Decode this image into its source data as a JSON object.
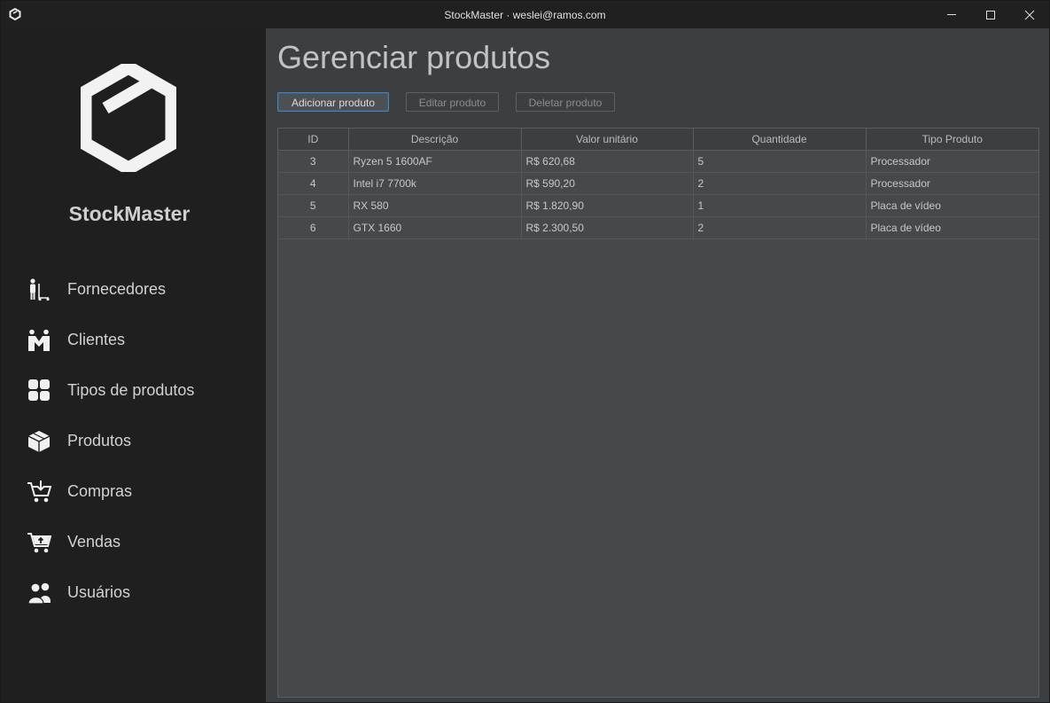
{
  "window": {
    "title": "StockMaster · weslei@ramos.com"
  },
  "sidebar": {
    "brand": "StockMaster",
    "items": [
      {
        "label": "Fornecedores",
        "icon": "supplier-dolly-icon"
      },
      {
        "label": "Clientes",
        "icon": "clients-icon"
      },
      {
        "label": "Tipos de produtos",
        "icon": "categories-grid-icon"
      },
      {
        "label": "Produtos",
        "icon": "box-icon"
      },
      {
        "label": "Compras",
        "icon": "cart-download-icon"
      },
      {
        "label": "Vendas",
        "icon": "cart-upload-icon"
      },
      {
        "label": "Usuários",
        "icon": "users-icon"
      }
    ]
  },
  "main": {
    "title": "Gerenciar produtos",
    "buttons": {
      "add": "Adicionar produto",
      "edit": "Editar produto",
      "delete": "Deletar produto"
    },
    "table": {
      "columns": [
        "ID",
        "Descrição",
        "Valor unitário",
        "Quantidade",
        "Tipo Produto"
      ],
      "rows": [
        [
          "3",
          "Ryzen 5 1600AF",
          "R$ 620,68",
          "5",
          "Processador"
        ],
        [
          "4",
          "Intel i7 7700k",
          "R$ 590,20",
          "2",
          "Processador"
        ],
        [
          "5",
          "RX 580",
          "R$ 1.820,90",
          "1",
          "Placa de vídeo"
        ],
        [
          "6",
          "GTX 1660",
          "R$ 2.300,50",
          "2",
          "Placa de vídeo"
        ]
      ]
    }
  },
  "colors": {
    "sidebar_bg": "#1f1f1f",
    "content_bg": "#3c3f41",
    "table_bg": "#45494a",
    "accent_border": "#4f7fb0"
  }
}
